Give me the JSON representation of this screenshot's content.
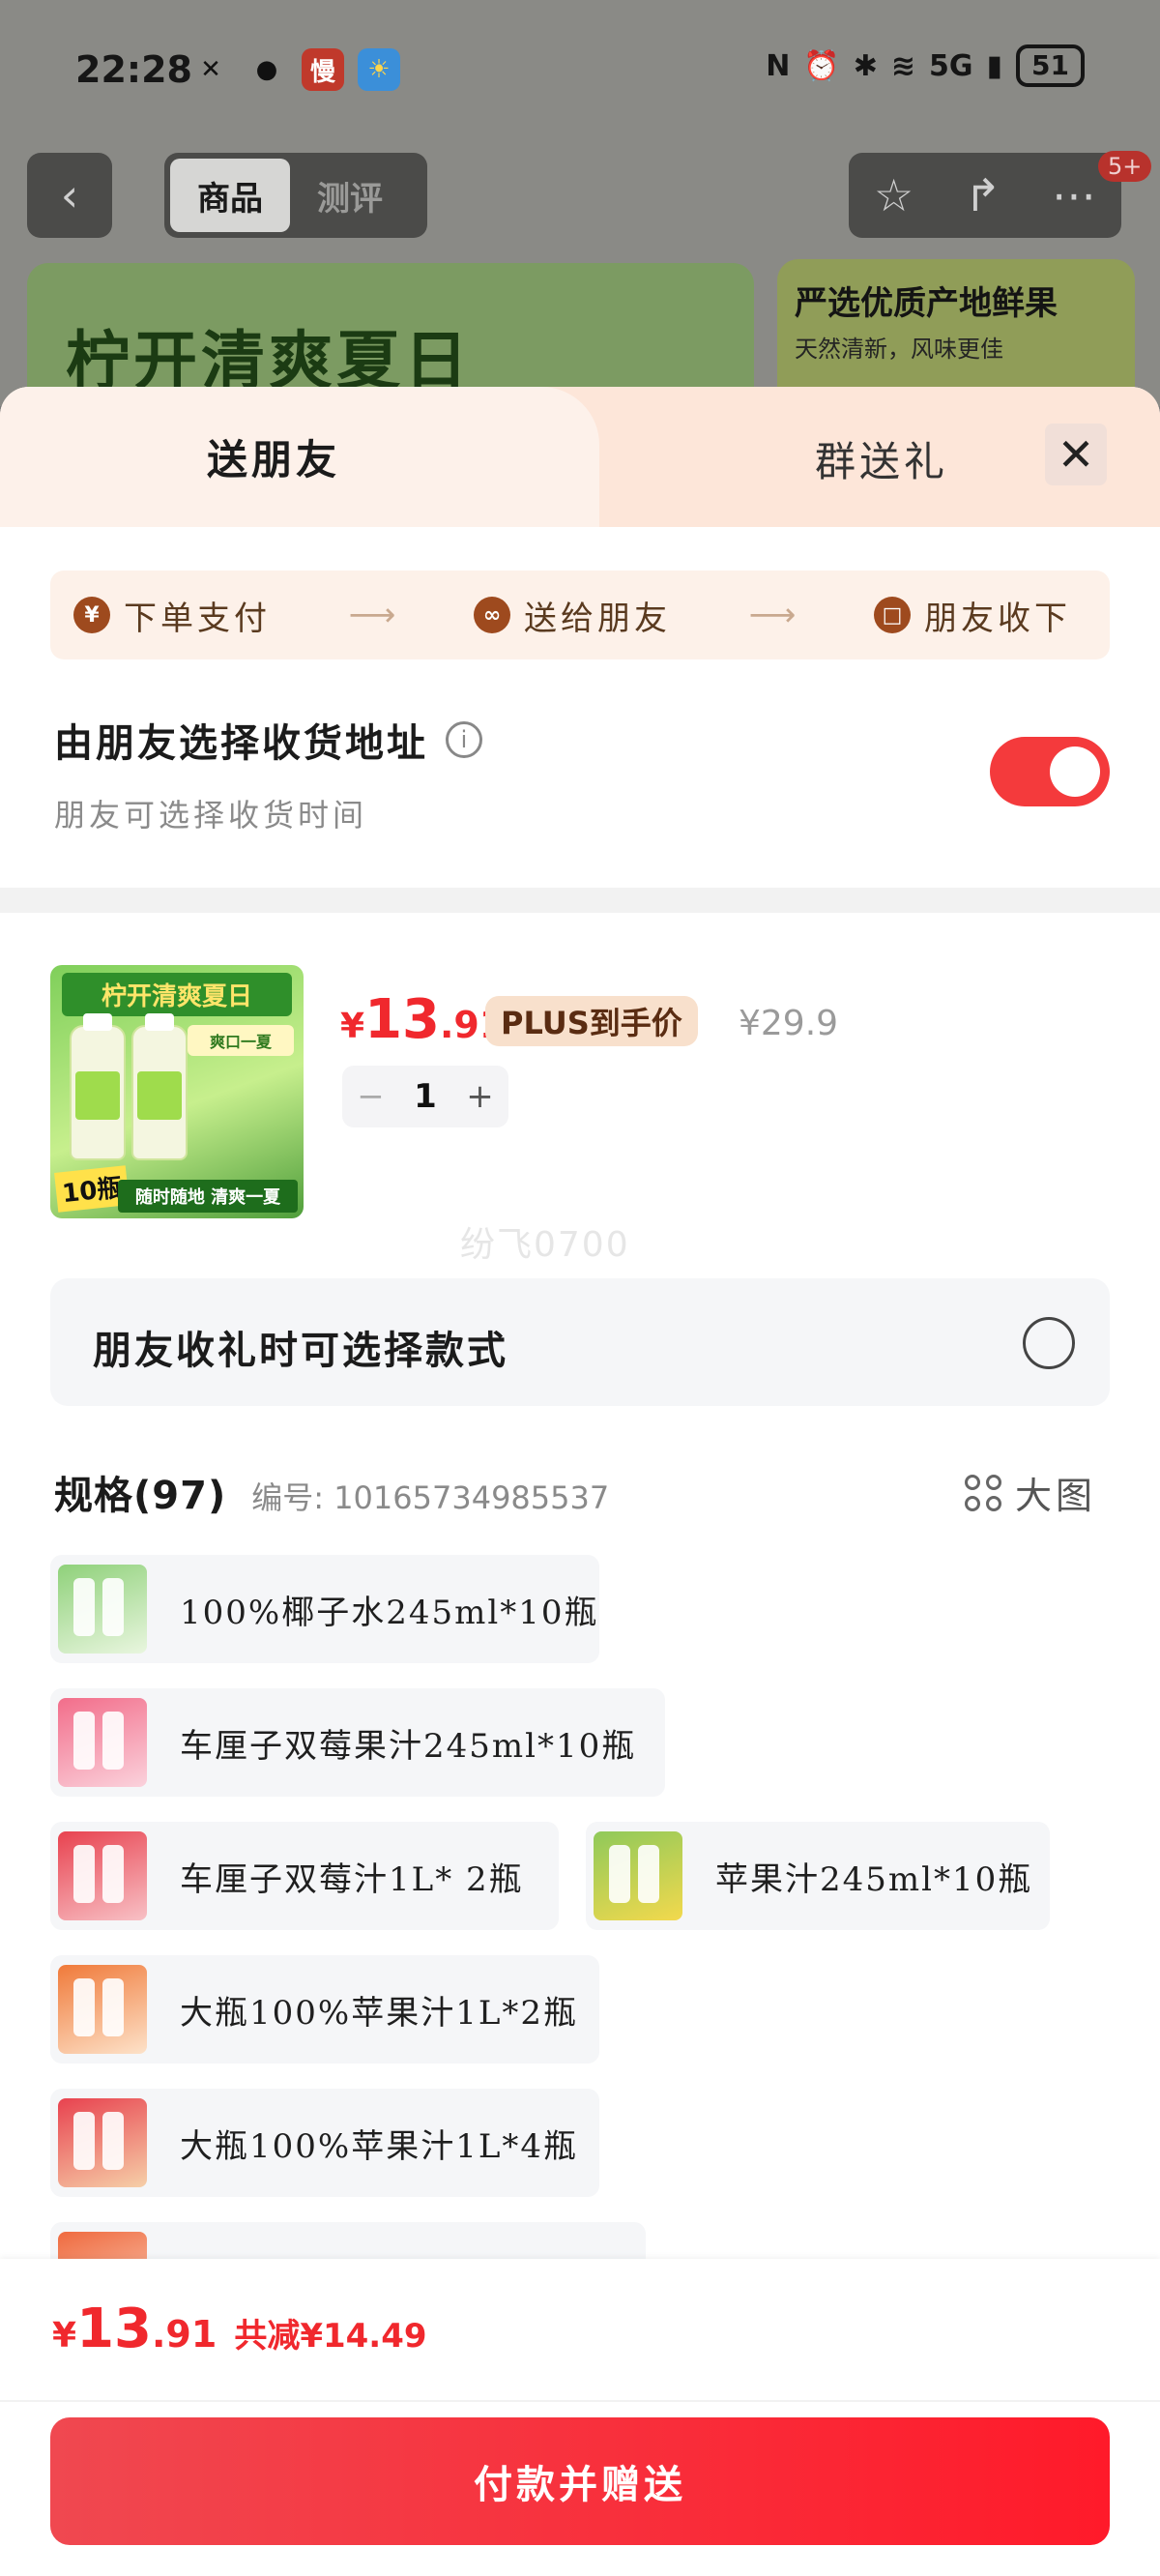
{
  "status_bar": {
    "time": "22:28",
    "app_icon_label": "慢",
    "signal": "5G",
    "battery": "51"
  },
  "nav": {
    "tabs": [
      "商品",
      "测评"
    ],
    "active_tab": 0,
    "badge": "5+"
  },
  "background_banners": {
    "left_title": "柠开清爽夏日",
    "right_title": "严选优质产地鲜果",
    "right_subtitle": "天然清新，风味更佳"
  },
  "sheet": {
    "tab_send": "送朋友",
    "tab_group": "群送礼",
    "steps": [
      {
        "label": "下单支付",
        "icon": "yen-icon",
        "glyph": "¥"
      },
      {
        "label": "送给朋友",
        "icon": "chat-icon",
        "glyph": "∞"
      },
      {
        "label": "朋友收下",
        "icon": "gift-icon",
        "glyph": "□"
      }
    ],
    "address_title": "由朋友选择收货地址",
    "address_subtitle": "朋友可选择收货时间",
    "address_toggle_on": true
  },
  "product": {
    "image_title": "柠开清爽夏日",
    "image_badge": "爽口一夏",
    "image_count": "10瓶",
    "image_footer": "随时随地 清爽一夏",
    "currency": "¥",
    "price_int": "13",
    "price_dec": ".91",
    "plus_tag": "PLUS到手价",
    "original_price": "¥29.9",
    "quantity": "1",
    "minus": "−",
    "plus": "+"
  },
  "watermark": "纷飞0700",
  "style_option": {
    "label": "朋友收礼时可选择款式",
    "checked": false
  },
  "spec": {
    "title": "规格(97)",
    "code": "编号: 10165734985537",
    "big_image_label": "大图",
    "items": [
      "100%椰子水245ml*10瓶",
      "车厘子双莓果汁245ml*10瓶",
      "车厘子双莓汁1L* 2瓶",
      "苹果汁245ml*10瓶",
      "大瓶100%苹果汁1L*2瓶",
      "大瓶100%苹果汁1L*4瓶"
    ]
  },
  "footer": {
    "currency": "¥",
    "price_int": "13",
    "price_dec": ".91",
    "saving": "共减¥14.49",
    "pay_button": "付款并赠送"
  },
  "colors": {
    "accent_red": "#f0282d",
    "toggle_on": "#f43a3c",
    "plus_tag_bg": "#f8e0cc",
    "sheet_header_bg": "#fde6d9"
  }
}
